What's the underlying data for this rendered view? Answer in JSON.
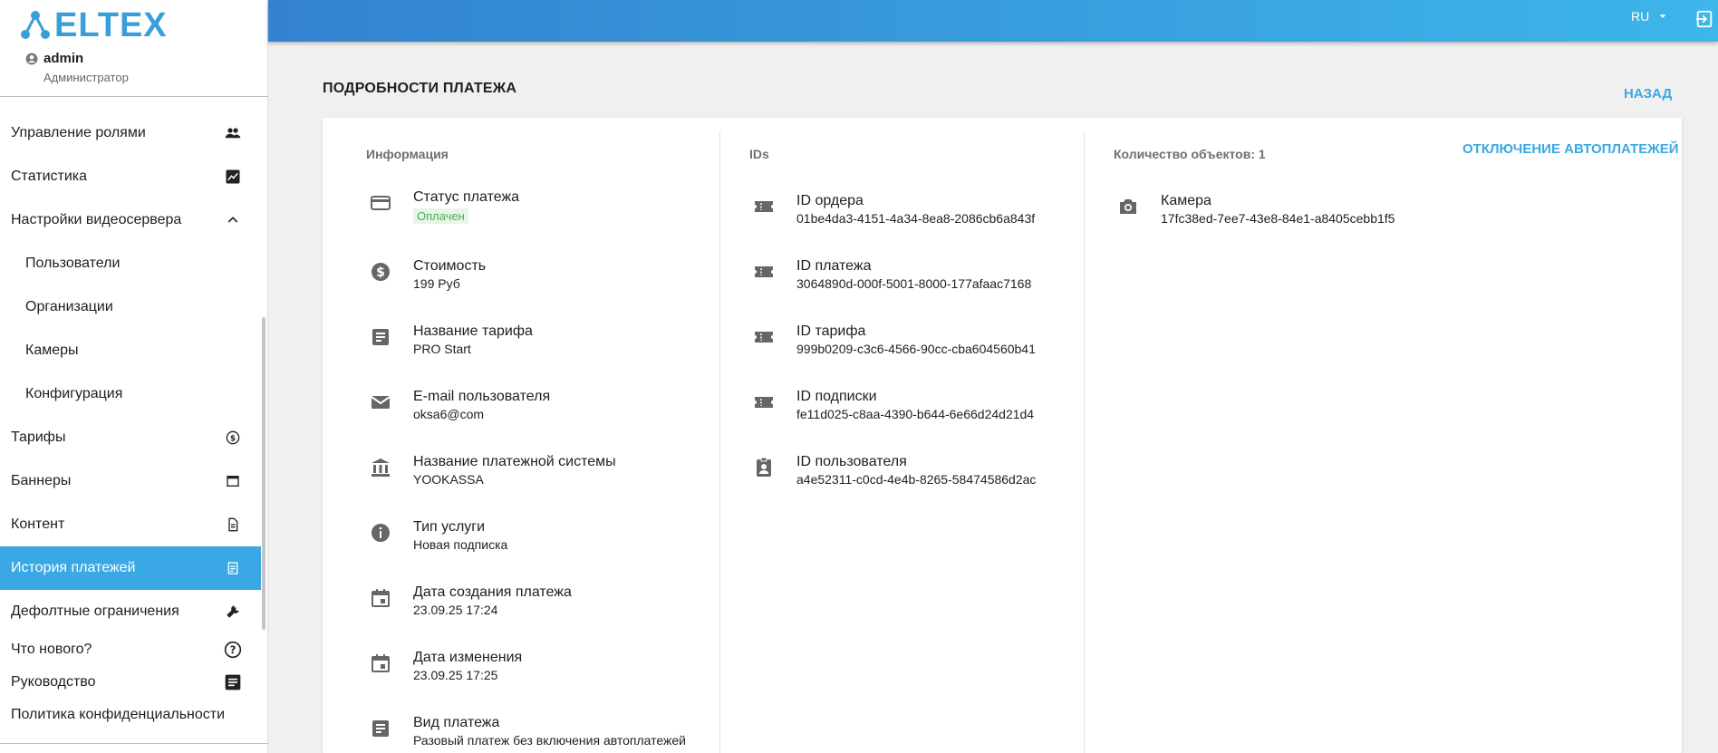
{
  "brand": {
    "name": "ELTEX",
    "color": "#3a9fd8"
  },
  "user": {
    "name": "admin",
    "role": "Администратор"
  },
  "nav": [
    {
      "label": "Управление ролями",
      "icon": "people-icon"
    },
    {
      "label": "Статистика",
      "icon": "chart-icon"
    },
    {
      "label": "Настройки видеосервера",
      "icon": "chevron-up-icon"
    },
    {
      "label": "Пользователи"
    },
    {
      "label": "Организации"
    },
    {
      "label": "Камеры"
    },
    {
      "label": "Конфигурация"
    },
    {
      "label": "Тарифы",
      "icon": "dollar-icon"
    },
    {
      "label": "Баннеры",
      "icon": "window-icon"
    },
    {
      "label": "Контент",
      "icon": "document-icon"
    },
    {
      "label": "История платежей",
      "icon": "receipt-icon",
      "active": true
    },
    {
      "label": "Дефолтные ограничения",
      "icon": "wrench-icon"
    },
    {
      "label": "Что нового?",
      "icon": "help-icon"
    },
    {
      "label": "Руководство",
      "icon": "article-icon"
    },
    {
      "label": "Политика конфиденциальности"
    }
  ],
  "topbar": {
    "lang": "RU"
  },
  "page": {
    "title": "ПОДРОБНОСТИ ПЛАТЕЖА",
    "back": "НАЗАД",
    "disable_autopay": "ОТКЛЮЧЕНИЕ АВТОПЛАТЕЖЕЙ"
  },
  "info": {
    "heading": "Информация",
    "items": [
      {
        "title": "Статус платежа",
        "value": "Оплачен",
        "icon": "credit-card-icon"
      },
      {
        "title": "Стоимость",
        "value": "199 Руб",
        "icon": "dollar-circle-icon"
      },
      {
        "title": "Название тарифа",
        "value": "PRO Start",
        "icon": "article-icon"
      },
      {
        "title": "E-mail пользователя",
        "value": "oksa6@com",
        "icon": "mail-icon"
      },
      {
        "title": "Название платежной системы",
        "value": "YOOKASSA",
        "icon": "bank-icon"
      },
      {
        "title": "Тип услуги",
        "value": "Новая подписка",
        "icon": "info-icon"
      },
      {
        "title": "Дата создания платежа",
        "value": "23.09.25 17:24",
        "icon": "calendar-icon"
      },
      {
        "title": "Дата изменения",
        "value": "23.09.25 17:25",
        "icon": "calendar-icon"
      },
      {
        "title": "Вид платежа",
        "value": "Разовый платеж без включения автоплатежей",
        "icon": "article-icon"
      }
    ]
  },
  "ids": {
    "heading": "IDs",
    "items": [
      {
        "title": "ID ордера",
        "value": "01be4da3-4151-4a34-8ea8-2086cb6a843f",
        "icon": "ticket-icon"
      },
      {
        "title": "ID платежа",
        "value": "3064890d-000f-5001-8000-177afaac7168",
        "icon": "ticket-icon"
      },
      {
        "title": "ID тарифа",
        "value": "999b0209-c3c6-4566-90cc-cba604560b41",
        "icon": "ticket-icon"
      },
      {
        "title": "ID подписки",
        "value": "fe11d025-c8aa-4390-b644-6e66d24d21d4",
        "icon": "ticket-icon"
      },
      {
        "title": "ID пользователя",
        "value": "a4e52311-c0cd-4e4b-8265-58474586d2ac",
        "icon": "badge-icon"
      }
    ]
  },
  "objects": {
    "heading": "Количество объектов: 1",
    "items": [
      {
        "title": "Камера",
        "value": "17fc38ed-7ee7-43e8-84e1-a8405cebb1f5",
        "icon": "camera-icon"
      }
    ]
  },
  "colors": {
    "accent": "#3aa8e4",
    "paid": "#4caf50"
  }
}
